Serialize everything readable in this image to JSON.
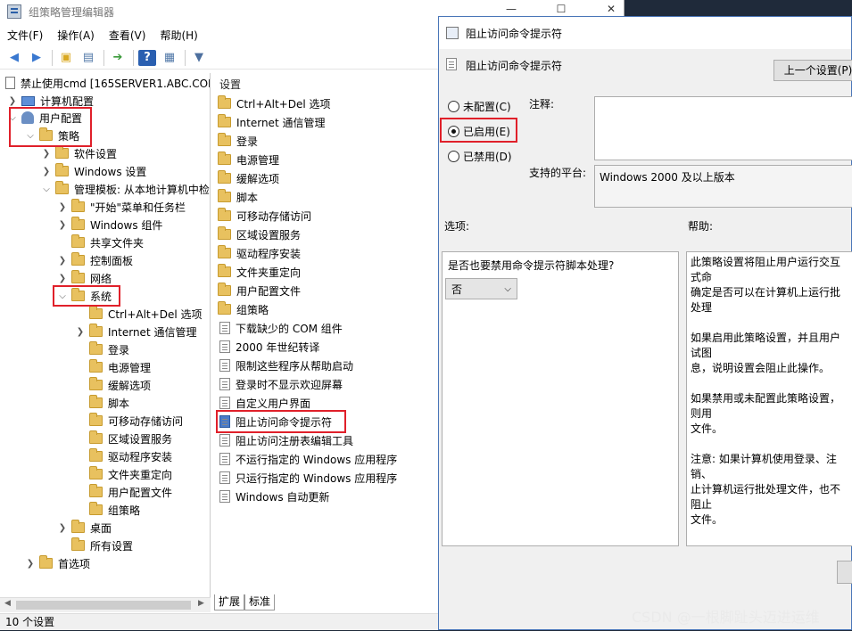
{
  "window": {
    "title": "组策略管理编辑器"
  },
  "menu": [
    "文件(F)",
    "操作(A)",
    "查看(V)",
    "帮助(H)"
  ],
  "tree": {
    "root": "禁止使用cmd [165SERVER1.ABC.COI",
    "computer_config": "计算机配置",
    "user_config": "用户配置",
    "policies": "策略",
    "software_settings": "软件设置",
    "windows_settings": "Windows 设置",
    "admin_templates": "管理模板: 从本地计算机中检",
    "start_menu": "\"开始\"菜单和任务栏",
    "windows_components": "Windows 组件",
    "shared_folders": "共享文件夹",
    "control_panel": "控制面板",
    "network": "网络",
    "system": "系统",
    "system_children": [
      "Ctrl+Alt+Del 选项",
      "Internet 通信管理",
      "登录",
      "电源管理",
      "缓解选项",
      "脚本",
      "可移动存储访问",
      "区域设置服务",
      "驱动程序安装",
      "文件夹重定向",
      "用户配置文件",
      "组策略"
    ],
    "desktop": "桌面",
    "all_settings": "所有设置",
    "preferences": "首选项"
  },
  "list": {
    "header": "设置",
    "folders": [
      "Ctrl+Alt+Del 选项",
      "Internet 通信管理",
      "登录",
      "电源管理",
      "缓解选项",
      "脚本",
      "可移动存储访问",
      "区域设置服务",
      "驱动程序安装",
      "文件夹重定向",
      "用户配置文件",
      "组策略"
    ],
    "policies": [
      "下载缺少的 COM 组件",
      "2000 年世纪转译",
      "限制这些程序从帮助启动",
      "登录时不显示欢迎屏幕",
      "自定义用户界面",
      "阻止访问命令提示符",
      "阻止访问注册表编辑工具",
      "不运行指定的 Windows 应用程序",
      "只运行指定的 Windows 应用程序",
      "Windows 自动更新"
    ],
    "selected_index": 5
  },
  "tabs": [
    "扩展",
    "标准"
  ],
  "status": "10 个设置",
  "dialog": {
    "title": "阻止访问命令提示符",
    "subtitle": "阻止访问命令提示符",
    "prev_button": "上一个设置(P)",
    "radios": [
      "未配置(C)",
      "已启用(E)",
      "已禁用(D)"
    ],
    "selected_radio": 1,
    "comment_label": "注释:",
    "platform_label": "支持的平台:",
    "platform_value": "Windows 2000 及以上版本",
    "options_label": "选项:",
    "help_label": "帮助:",
    "option_question": "是否也要禁用命令提示符脚本处理?",
    "option_value": "否",
    "help_text": "此策略设置将阻止用户运行交互式命\n确定是否可以在计算机上运行批处理\n\n如果启用此策略设置，并且用户试图\n息，说明设置会阻止此操作。\n\n如果禁用或未配置此策略设置，则用\n文件。\n\n注意: 如果计算机使用登录、注销、\n止计算机运行批处理文件，也不阻止\n文件。"
  },
  "watermark": "CSDN @一根脚趾头迈进运维"
}
